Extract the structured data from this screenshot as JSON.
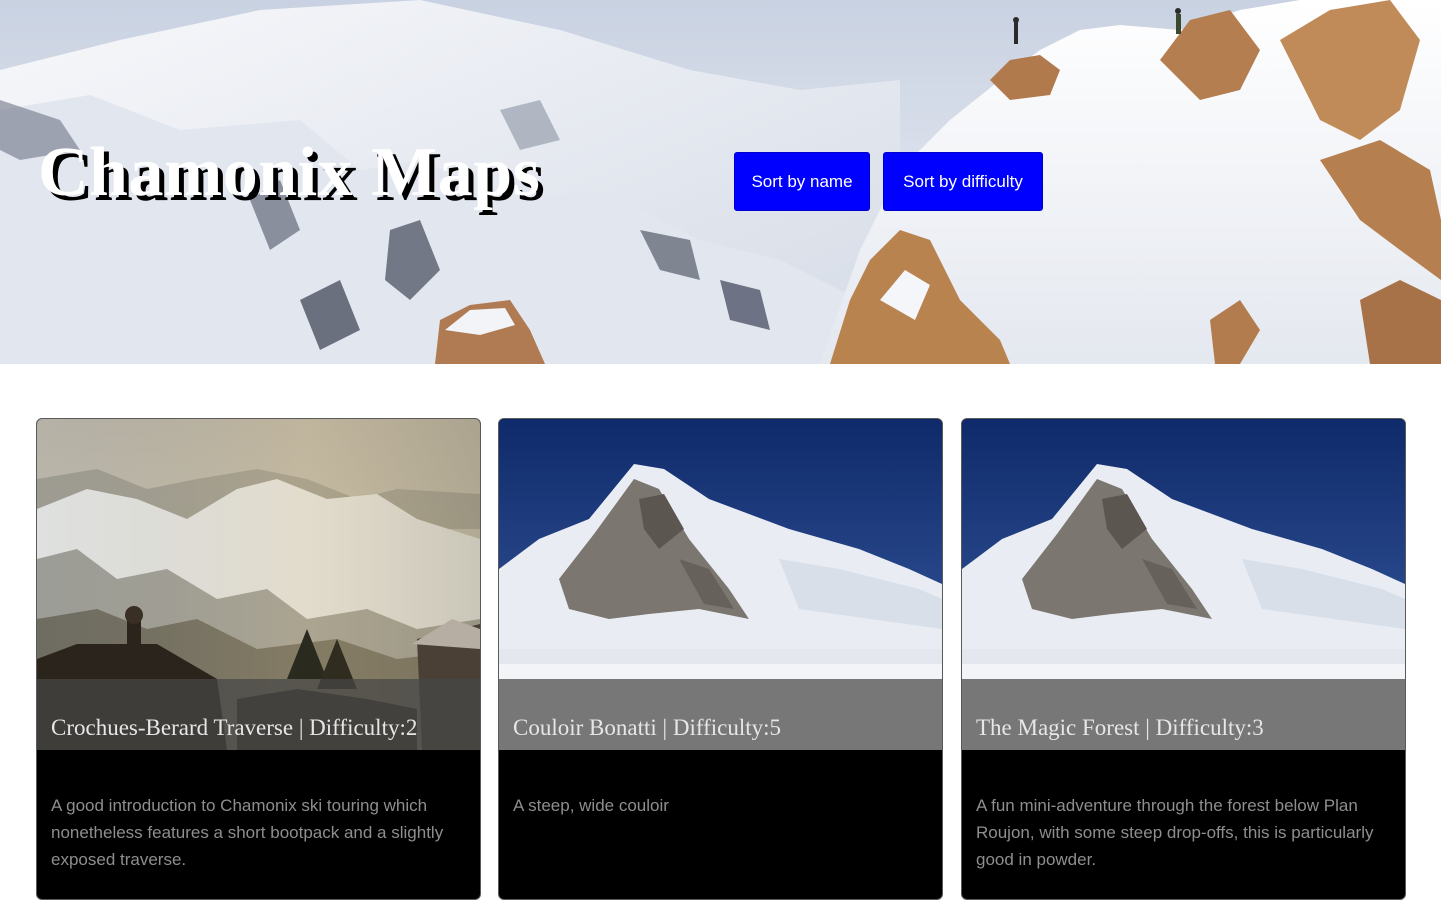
{
  "header": {
    "title": "Chamonix Maps",
    "sort_by_name_label": "Sort by name",
    "sort_by_difficulty_label": "Sort by difficulty"
  },
  "routes": [
    {
      "title": "Crochues-Berard Traverse | Difficulty:2",
      "description": "A good introduction to Chamonix ski touring which nonetheless features a short bootpack and a slightly exposed traverse."
    },
    {
      "title": "Couloir Bonatti | Difficulty:5",
      "description": "A steep, wide couloir"
    },
    {
      "title": "The Magic Forest | Difficulty:3",
      "description": "A fun mini-adventure through the forest below Plan Roujon, with some steep drop-offs, this is particularly good in powder."
    }
  ],
  "colors": {
    "button_bg": "#0000ff",
    "card_bg": "#000000"
  }
}
